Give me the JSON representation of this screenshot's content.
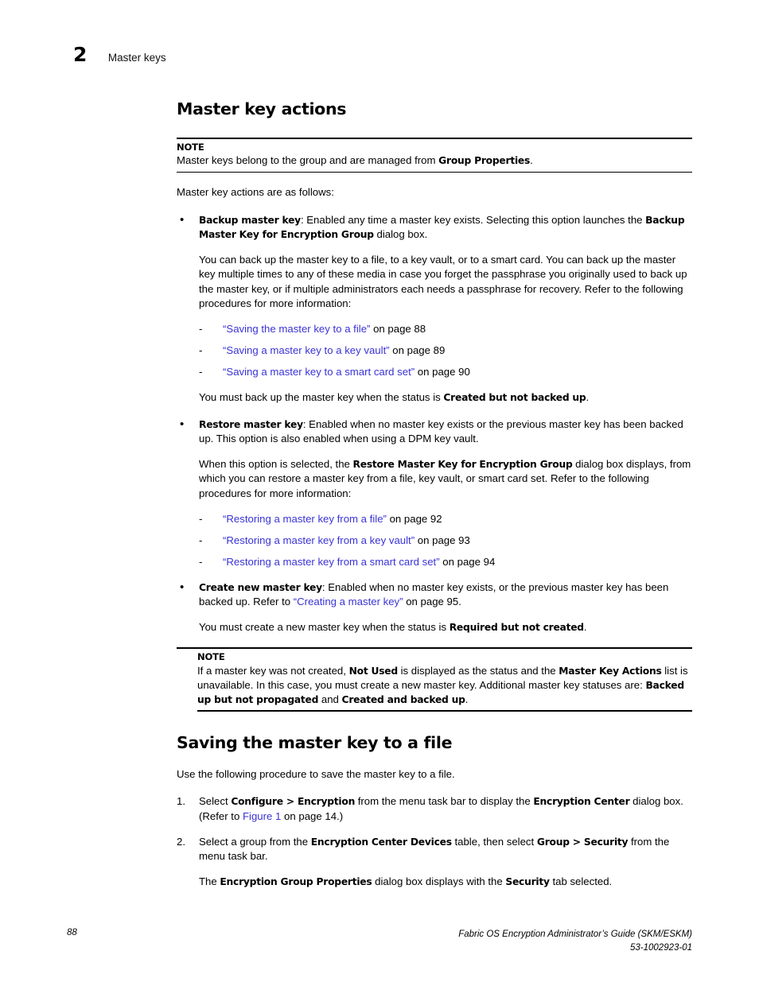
{
  "header": {
    "chapter_number": "2",
    "chapter_title": "Master keys"
  },
  "sections": {
    "master_key_actions": {
      "heading": "Master key actions",
      "note1": {
        "label": "NOTE",
        "text_before": "Master keys belong to the group and are managed from ",
        "bold1": "Group Properties",
        "text_after": "."
      },
      "intro": "Master key actions are as follows:",
      "bullets": [
        {
          "term": "Backup master key",
          "text1": ": Enabled any time a master key exists. Selecting this option launches the ",
          "bold2": "Backup Master Key for Encryption Group",
          "text2": " dialog box.",
          "paragraph": "You can back up the master key to a file, to a key vault, or to a smart card. You can back up the master key multiple times to any of these media in case you forget the passphrase you originally used to back up the master key, or if multiple administrators each needs a passphrase for recovery. Refer to the following procedures for more information:",
          "links": [
            {
              "link": "“Saving the master key to a file”",
              "tail": " on page 88"
            },
            {
              "link": "“Saving a master key to a key vault”",
              "tail": " on page 89"
            },
            {
              "link": "“Saving a master key to a smart card set”",
              "tail": " on page 90"
            }
          ],
          "closing_before": "You must back up the master key when the status is ",
          "closing_bold": "Created but not backed up",
          "closing_after": "."
        },
        {
          "term": "Restore master key",
          "text1": ": Enabled when no master key exists or the previous master key has been backed up. This option is also enabled when using a DPM key vault.",
          "paragraph_before": "When this option is selected, the ",
          "paragraph_bold": "Restore Master Key for Encryption Group",
          "paragraph_after": " dialog box displays, from which you can restore a master key from a file, key vault, or smart card set. Refer to the following procedures for more information:",
          "links": [
            {
              "link": "“Restoring a master key from a file”",
              "tail": " on page 92"
            },
            {
              "link": "“Restoring a master key from a key vault”",
              "tail": " on page 93"
            },
            {
              "link": "“Restoring a master key from a smart card set”",
              "tail": " on page 94"
            }
          ]
        },
        {
          "term": "Create new master key",
          "text1": ": Enabled when no master key exists, or the previous master key has been backed up. Refer to ",
          "link": "“Creating a master key”",
          "text2": " on page 95.",
          "closing_before": "You must create a new master key when the status is ",
          "closing_bold": "Required but not created",
          "closing_after": "."
        }
      ],
      "note2": {
        "label": "NOTE",
        "t1": "If a master key was not created, ",
        "b1": "Not Used",
        "t2": " is displayed as the status and the ",
        "b2": "Master Key Actions",
        "t3": " list is unavailable. In this case, you must create a new master key. Additional master key statuses are: ",
        "b3": "Backed up but not propagated",
        "t4": " and ",
        "b4": "Created and backed up",
        "t5": "."
      }
    },
    "saving_master_key": {
      "heading": "Saving the master key to a file",
      "intro": "Use the following procedure to save the master key to a file.",
      "steps": [
        {
          "num": "1.",
          "t1": "Select ",
          "b1": "Configure > Encryption",
          "t2": " from the menu task bar to display the ",
          "b2": "Encryption Center",
          "t3": " dialog box. (Refer to ",
          "link": "Figure 1",
          "t4": " on page 14.)"
        },
        {
          "num": "2.",
          "t1": "Select a group from the ",
          "b1": "Encryption Center Devices",
          "t2": " table, then select ",
          "b2": "Group > Security",
          "t3": " from the menu task bar.",
          "follow_t1": "The ",
          "follow_b1": "Encryption Group Properties",
          "follow_t2": " dialog box displays with the ",
          "follow_b2": "Security",
          "follow_t3": " tab selected."
        }
      ]
    }
  },
  "footer": {
    "page_number": "88",
    "doc_title": "Fabric OS Encryption Administrator’s Guide (SKM/ESKM)",
    "doc_number": "53-1002923-01"
  },
  "colors": {
    "link": "#3a33d6",
    "text": "#000000",
    "background": "#ffffff"
  }
}
